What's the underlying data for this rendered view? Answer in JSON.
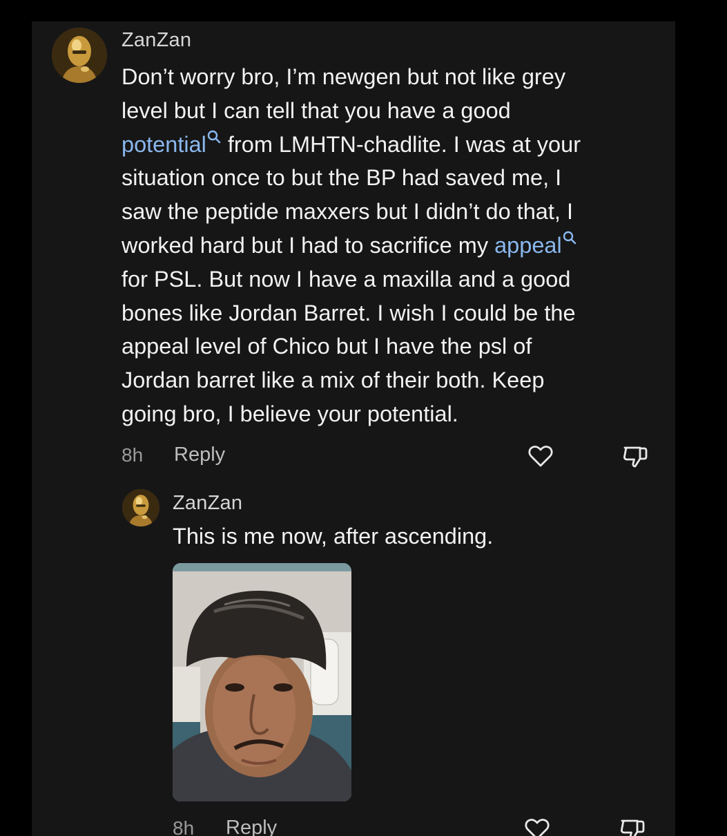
{
  "comments": [
    {
      "username": "ZanZan",
      "lines": [
        "Don’t worry bro, I’m newgen but not like grey",
        "level but I can tell that you have a good",
        {
          "keyword": "potential",
          "rest": " from LMHTN-chadlite. I was at your"
        },
        "situation once to but the BP had saved me, I",
        "saw the peptide maxxers but I didn’t do that, I",
        {
          "before": "worked hard but I had to sacrifice my ",
          "keyword": "appeal"
        },
        "for PSL. But now I have a maxilla and a good",
        "bones like Jordan Barret. I wish I could be the",
        "appeal level of Chico but I have the psl of",
        "Jordan barret like a mix of their both. Keep",
        "going bro, I believe your potential."
      ],
      "time": "8h",
      "reply_label": "Reply"
    },
    {
      "username": "ZanZan",
      "text": "This is me now, after ascending.",
      "time": "8h",
      "reply_label": "Reply"
    }
  ],
  "icons": {
    "keyword_search": "search-icon",
    "like": "heart-icon",
    "dislike": "thumbs-down-icon"
  },
  "colors": {
    "background": "#161616",
    "keyword": "#8ab8ee",
    "text": "#f2f2f2",
    "meta": "#9a9a9a"
  }
}
